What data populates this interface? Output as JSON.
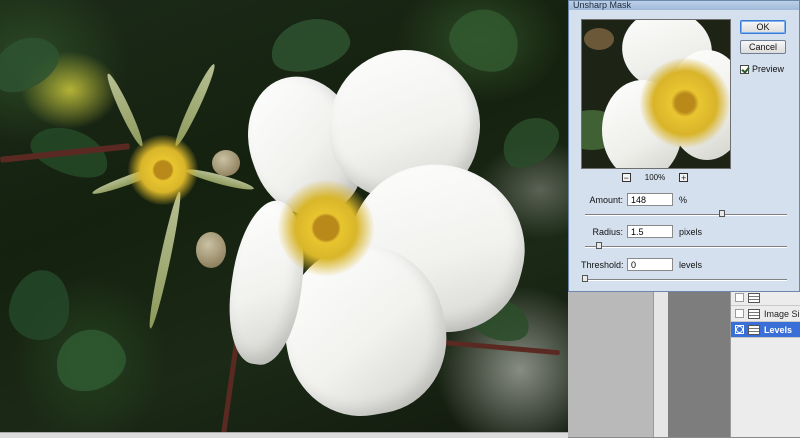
{
  "dialog": {
    "title": "Unsharp Mask",
    "ok_label": "OK",
    "cancel_label": "Cancel",
    "preview_label": "Preview",
    "preview_checked": true,
    "zoom_minus": "−",
    "zoom_plus": "+",
    "zoom_level": "100%",
    "amount": {
      "label": "Amount:",
      "value": "148",
      "unit": "%",
      "slider_fraction": 0.68
    },
    "radius": {
      "label": "Radius:",
      "value": "1.5",
      "unit": "pixels",
      "slider_fraction": 0.07
    },
    "threshold": {
      "label": "Threshold:",
      "value": "0",
      "unit": "levels",
      "slider_fraction": 0.0
    }
  },
  "layers": {
    "items": [
      {
        "name": ""
      },
      {
        "name": "Image Si"
      },
      {
        "name": "Levels",
        "selected": true
      }
    ]
  },
  "colors": {
    "dialog_bg": "#d4e0ee",
    "selected_layer": "#3b6fd8",
    "stamen_yellow": "#e8c52f"
  }
}
